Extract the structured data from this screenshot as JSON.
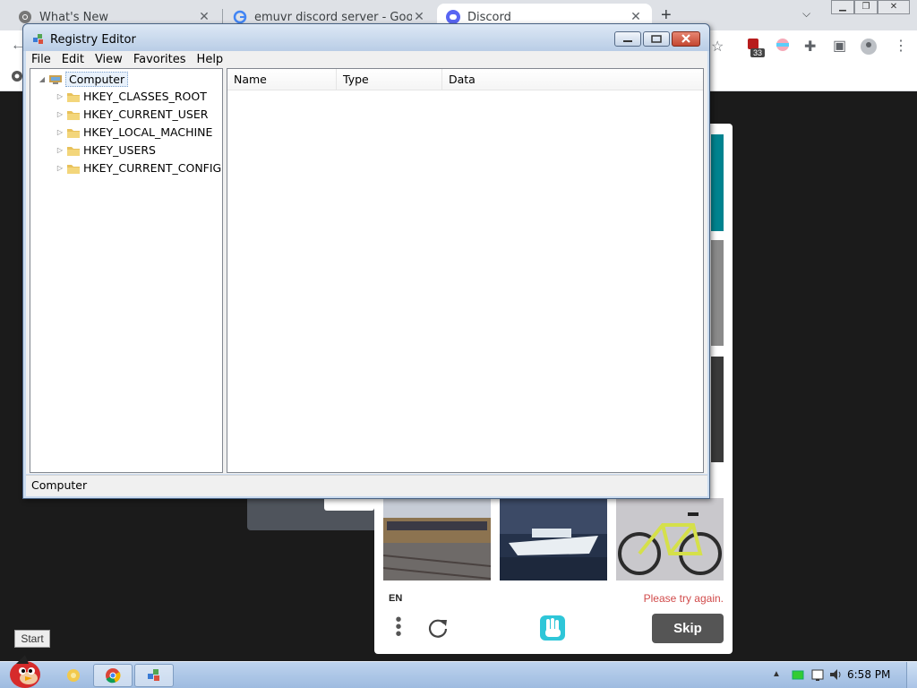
{
  "browser": {
    "tabs": [
      {
        "label": "What's New",
        "icon": "chrome-icon",
        "active": false
      },
      {
        "label": "emuvr discord server - Google",
        "icon": "google-icon",
        "active": false
      },
      {
        "label": "Discord",
        "icon": "discord-icon",
        "active": true
      }
    ],
    "extension_badge": "33"
  },
  "captcha": {
    "language": "EN",
    "error": "Please try again.",
    "skip_label": "Skip"
  },
  "regedit": {
    "title": "Registry Editor",
    "menu": [
      "File",
      "Edit",
      "View",
      "Favorites",
      "Help"
    ],
    "tree": {
      "root": "Computer",
      "hives": [
        "HKEY_CLASSES_ROOT",
        "HKEY_CURRENT_USER",
        "HKEY_LOCAL_MACHINE",
        "HKEY_USERS",
        "HKEY_CURRENT_CONFIG"
      ]
    },
    "columns": [
      "Name",
      "Type",
      "Data"
    ],
    "status": "Computer"
  },
  "taskbar": {
    "start_tooltip": "Start",
    "clock": "6:58 PM"
  },
  "colors": {
    "accent_teal": "#00838f",
    "error_red": "#d14b4b",
    "skip_button": "#555555"
  }
}
